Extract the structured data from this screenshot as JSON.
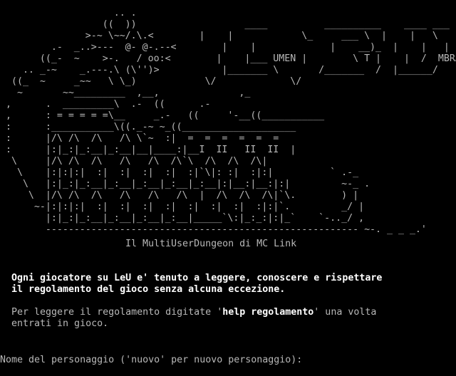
{
  "colors": {
    "background": "#000000",
    "text": "#b8b8b8",
    "bright_text": "#ffffff"
  },
  "banner": {
    "ascii_art": "                    .. .\n                  ((  ))                   ____          __________    ____ ___\n               >-~ \\~~/.\\.<        |    |            \\_     ___ \\  |    |   \\\n         .-  _..>---  @- @-.--<        |    |             |    __)_  |    |   |\n       ((_-  ~    >-.   / oo:<        |    |___ UMEN |        \\ T |    |  /  MBRA\n    .. _-~    _.---.\\ (\\'')>           |_______ \\       /_______  /  |______/\n  ((_  ~     _~~   \\ \\_)            \\/             \\/\n   ~       ~~_________  ,__,              ,_\n ,      .  _________\\  .-  ((      .-\n ,      : = = = = =\\__     _.-   ((     '-__((___________\n :      :___________\\((._-~ ~_((____________________\n :      |/\\ /\\  /\\   /\\ \\`~  :|  =  =  =  =  =  =\n :      |:|_:|_:__|_:__|__|____:|__I  II   II  II  |\n  \\     |/\\ /\\  /\\   /\\   /\\  /\\`\\  /\\  /\\  /\\|\n   \\    |:|:|:|  :|  :|  :|  :|  :|`\\|: :|  :|:|          ` .-_\n    \\   |:|_:|_:__|_:__|_:__|_:__|_:__|:|__:|__:|:|         ~-_ .\n     \\  |/\\ /\\  /\\   /\\   /\\   /\\  |  /\\  /\\  /\\|`\\.        ) |\n      ~-|:|:|:|  :|  :|  :|  :|  :|  :|  :|  :|:|`.         _/ |\n        |:|_:|_:__|_:__|_:__|_:__|_____`\\:|_:_:|:|_`    `-.._/ ,\n        ------------------------------------------------------- ~-. _ _ _.' ",
    "subtitle": "Il MultiUserDungeon di MC Link"
  },
  "notice": {
    "line1": "Ogni giocatore su LeU e' tenuto a leggere, conoscere e rispettare",
    "line2": "il regolamento del gioco senza alcuna eccezione."
  },
  "help": {
    "line1_prefix": "Per leggere il regolamento digitate '",
    "line1_command": "help regolamento",
    "line1_suffix": "' una volta",
    "line2": "entrati in gioco."
  },
  "prompt": {
    "text": "Nome del personaggio ('nuovo' per nuovo personaggio):",
    "input_value": ""
  }
}
